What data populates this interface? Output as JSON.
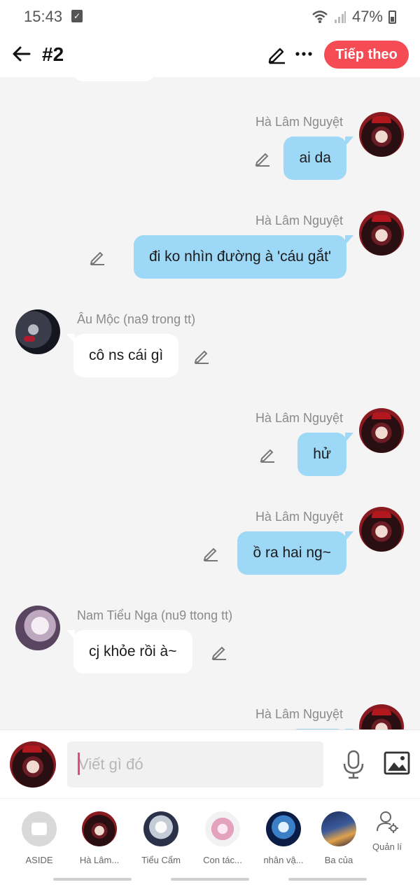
{
  "status": {
    "time": "15:43",
    "battery": "47%"
  },
  "header": {
    "title": "#2",
    "next_label": "Tiếp theo"
  },
  "messages": [
    {
      "side": "right",
      "name": "Hà Lâm Nguyệt",
      "text": "ai da"
    },
    {
      "side": "right",
      "name": "Hà Lâm Nguyệt",
      "text": "đi ko nhìn đường à 'cáu gắt'"
    },
    {
      "side": "left",
      "name": "Âu Mộc (na9 trong tt)",
      "text": "cô ns cái gì"
    },
    {
      "side": "right",
      "name": "Hà Lâm Nguyệt",
      "text": "hử"
    },
    {
      "side": "right",
      "name": "Hà Lâm Nguyệt",
      "text": "ồ ra hai ng~"
    },
    {
      "side": "left",
      "name": "Nam Tiểu Nga (nu9 ttong tt)",
      "text": "cj khỏe rồi à~"
    },
    {
      "side": "right",
      "name": "Hà Lâm Nguyệt",
      "text": ""
    }
  ],
  "composer": {
    "placeholder": "Viết gì đó"
  },
  "characters": [
    {
      "label": "ASIDE"
    },
    {
      "label": "Hà Lâm..."
    },
    {
      "label": "Tiểu Cẩm"
    },
    {
      "label": "Con tác..."
    },
    {
      "label": "nhân vậ..."
    },
    {
      "label": "Ba của"
    }
  ],
  "manage_label": "Quản lí",
  "colors": {
    "accent": "#f44b55",
    "bubble_right": "#9ed8f7",
    "bubble_left": "#ffffff"
  }
}
